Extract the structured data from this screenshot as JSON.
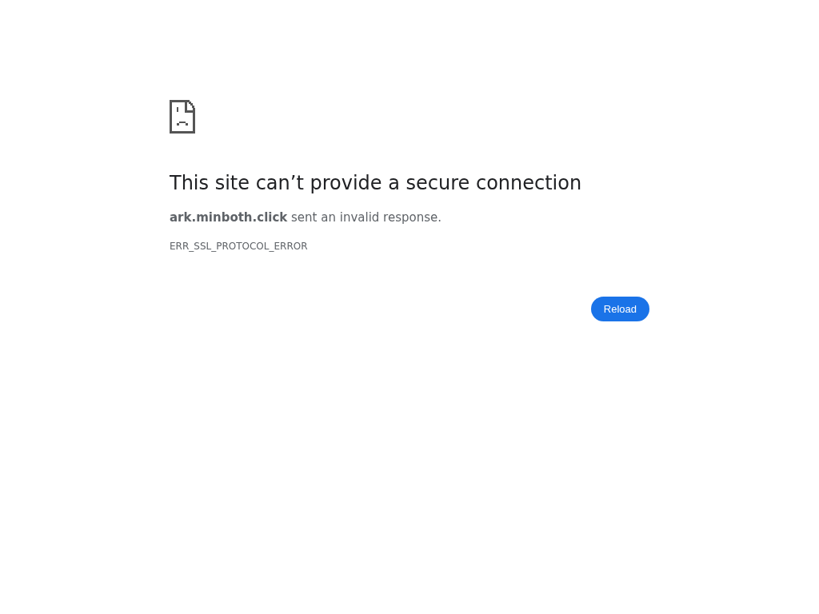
{
  "error_page": {
    "heading": "This site can’t provide a secure connection",
    "message": "**ark.minboth.click** sent an invalid response.",
    "error_code": "ERR_SSL_PROTOCOL_ERROR",
    "button": "Reload"
  }
}
